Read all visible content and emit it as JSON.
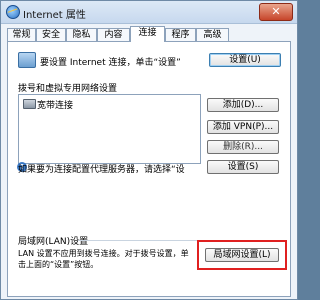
{
  "window": {
    "title": "Internet 属性",
    "close_glyph": "✕"
  },
  "tabs": [
    {
      "label": "常规"
    },
    {
      "label": "安全"
    },
    {
      "label": "隐私"
    },
    {
      "label": "内容"
    },
    {
      "label": "连接",
      "active": true
    },
    {
      "label": "程序"
    },
    {
      "label": "高级"
    }
  ],
  "setup": {
    "text": "要设置 Internet 连接，单击“设置”",
    "button": "设置(U)"
  },
  "dialup": {
    "header": "拨号和虚拟专用网络设置",
    "items": [
      "宽带连接"
    ],
    "add_button": "添加(D)...",
    "add_vpn_button": "添加 VPN(P)...",
    "delete_button": "删除(R)...",
    "proxy_text": "如果要为连接配置代理服务器，请选择“设",
    "settings_button": "设置(S)"
  },
  "lan": {
    "header": "局域网(LAN)设置",
    "description": "LAN 设置不应用到拨号连接。对于拨号设置，单击上面的“设置”按钮。",
    "button": "局域网设置(L)"
  },
  "colors": {
    "highlight": "#e02020",
    "accent": "#3c7fb1"
  }
}
